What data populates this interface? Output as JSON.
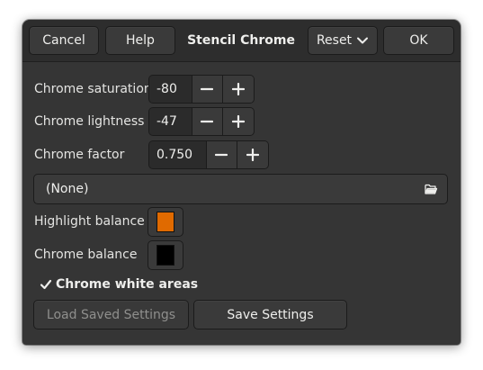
{
  "dialog": {
    "title": "Stencil Chrome"
  },
  "header": {
    "cancel_label": "Cancel",
    "help_label": "Help",
    "reset_label": "Reset",
    "ok_label": "OK"
  },
  "fields": {
    "chrome_saturation": {
      "label": "Chrome saturation",
      "value": "-80"
    },
    "chrome_lightness": {
      "label": "Chrome lightness",
      "value": "-47"
    },
    "chrome_factor": {
      "label": "Chrome factor",
      "value": "0.750"
    }
  },
  "environment_map": {
    "value": "(None)",
    "icon": "open-file-icon"
  },
  "colors": {
    "highlight_balance": {
      "label": "Highlight balance",
      "color": "#e06a00"
    },
    "chrome_balance": {
      "label": "Chrome balance",
      "color": "#000000"
    }
  },
  "chrome_white_areas": {
    "label": "Chrome white areas",
    "checked": true
  },
  "footer": {
    "load_label": "Load Saved Settings",
    "save_label": "Save Settings"
  },
  "theme": {
    "background": "#353535",
    "headerbar": "#2d2d2d",
    "text": "#eeeeec"
  }
}
